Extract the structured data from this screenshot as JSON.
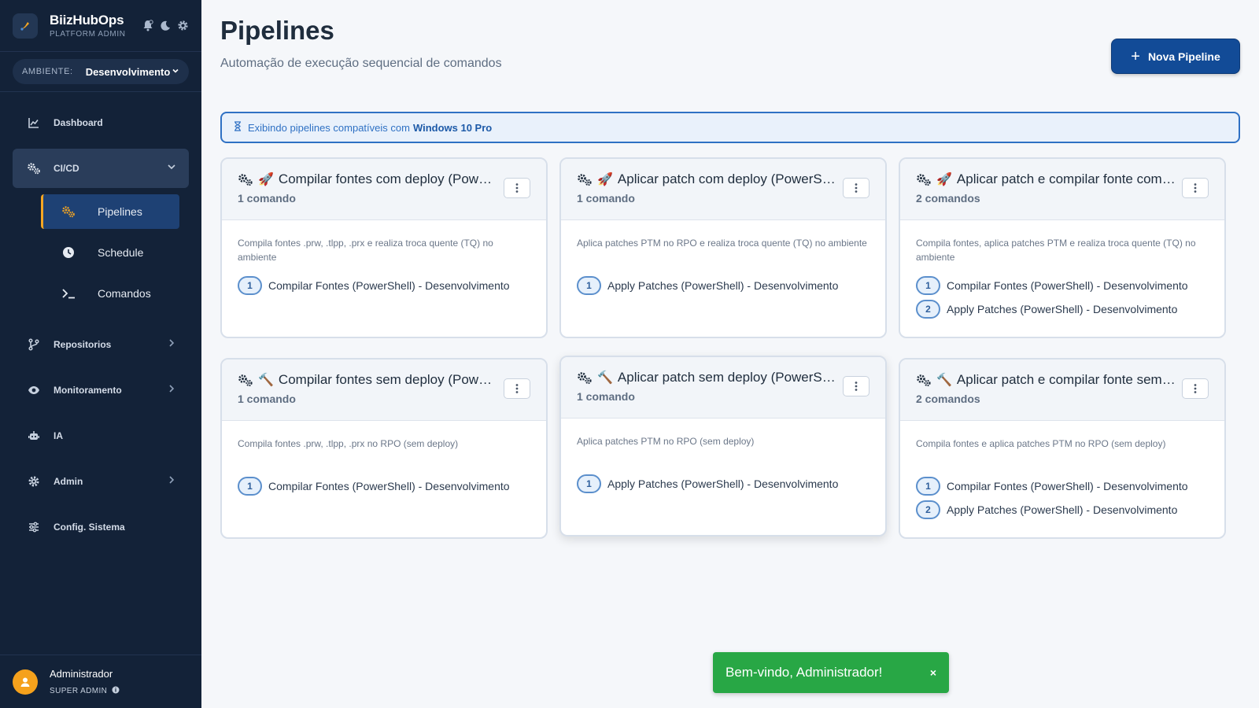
{
  "brand": {
    "title": "BiizHubOps",
    "subtitle": "PLATFORM ADMIN"
  },
  "environment": {
    "label": "AMBIENTE:",
    "value": "Desenvolvimento"
  },
  "nav": {
    "dashboard": "Dashboard",
    "cicd": "CI/CD",
    "pipelines": "Pipelines",
    "schedule": "Schedule",
    "comandos": "Comandos",
    "repositorios": "Repositorios",
    "monitoramento": "Monitoramento",
    "ia": "IA",
    "admin": "Admin",
    "config": "Config. Sistema"
  },
  "user": {
    "name": "Administrador",
    "role": "SUPER ADMIN"
  },
  "page": {
    "title": "Pipelines",
    "subtitle": "Automação de execução sequencial de comandos",
    "new_button": "Nova Pipeline",
    "new_button_icon": "+"
  },
  "info": {
    "text": "Exibindo pipelines compatíveis com",
    "os": "Windows 10 Pro"
  },
  "cards": [
    {
      "emoji": "🚀",
      "title": "Compilar fontes com deploy (PowerShell)",
      "count": "1 comando",
      "desc": "Compila fontes .prw, .tlpp, .prx e realiza troca quente (TQ) no ambiente",
      "steps": [
        {
          "n": "1",
          "label": "Compilar Fontes (PowerShell) - Desenvolvimento"
        }
      ]
    },
    {
      "emoji": "🚀",
      "title": "Aplicar patch com deploy (PowerShell)",
      "count": "1 comando",
      "desc": "Aplica patches PTM no RPO e realiza troca quente (TQ) no ambiente",
      "steps": [
        {
          "n": "1",
          "label": "Apply Patches (PowerShell) - Desenvolvimento"
        }
      ]
    },
    {
      "emoji": "🚀",
      "title": "Aplicar patch e compilar fonte com deploy (PowerShell)",
      "count": "2 comandos",
      "desc": "Compila fontes, aplica patches PTM e realiza troca quente (TQ) no ambiente",
      "steps": [
        {
          "n": "1",
          "label": "Compilar Fontes (PowerShell) - Desenvolvimento"
        },
        {
          "n": "2",
          "label": "Apply Patches (PowerShell) - Desenvolvimento"
        }
      ]
    },
    {
      "emoji": "🔨",
      "title": "Compilar fontes sem deploy (PowerShell)",
      "count": "1 comando",
      "desc": "Compila fontes .prw, .tlpp, .prx no RPO (sem deploy)",
      "steps": [
        {
          "n": "1",
          "label": "Compilar Fontes (PowerShell) - Desenvolvimento"
        }
      ]
    },
    {
      "emoji": "🔨",
      "title": "Aplicar patch sem deploy (PowerShell)",
      "count": "1 comando",
      "desc": "Aplica patches PTM no RPO (sem deploy)",
      "steps": [
        {
          "n": "1",
          "label": "Apply Patches (PowerShell) - Desenvolvimento"
        }
      ]
    },
    {
      "emoji": "🔨",
      "title": "Aplicar patch e compilar fonte sem deploy (PowerShell)",
      "count": "2 comandos",
      "desc": "Compila fontes e aplica patches PTM no RPO (sem deploy)",
      "steps": [
        {
          "n": "1",
          "label": "Compilar Fontes (PowerShell) - Desenvolvimento"
        },
        {
          "n": "2",
          "label": "Apply Patches (PowerShell) - Desenvolvimento"
        }
      ]
    }
  ],
  "toast": {
    "message": "Bem-vindo, Administrador!",
    "close": "×"
  },
  "colors": {
    "sidebar": "#132238",
    "primary": "#124b97",
    "accent": "#f5a623",
    "success": "#28a745",
    "info_border": "#2f71c4"
  }
}
